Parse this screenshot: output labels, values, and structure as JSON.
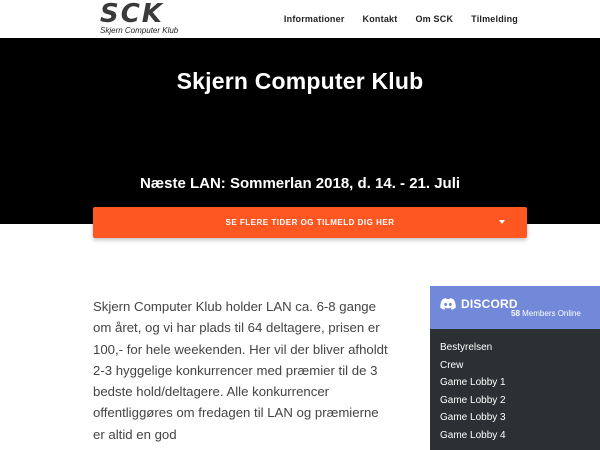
{
  "header": {
    "logo_text": "SCK",
    "logo_subtitle": "Skjern Computer Klub",
    "nav": [
      "Informationer",
      "Kontakt",
      "Om SCK",
      "Tilmelding"
    ]
  },
  "hero": {
    "title": "Skjern Computer Klub",
    "subtitle": "Næste LAN: Sommerlan 2018, d. 14. - 21. Juli"
  },
  "cta": {
    "label": "SE FLERE TIDER OG TILMELD DIG HER",
    "color": "#ff5722"
  },
  "intro": {
    "text": "Skjern Computer Klub holder LAN ca. 6-8 gange om året, og vi har plads til 64 deltagere, prisen er 100,- for hele weekenden. Her vil der bliver afholdt 2-3 hyggelige konkurrencer med præmier til de 3 bedste hold/deltagere. Alle konkurrencer offentliggøres om fredagen til LAN og præmierne er altid en god"
  },
  "discord": {
    "brand": "DISCORD",
    "members_count": "58",
    "members_label": "Members Online",
    "header_color": "#7289da",
    "channels": [
      "Bestyrelsen",
      "Crew",
      "Game Lobby 1",
      "Game Lobby 2",
      "Game Lobby 3",
      "Game Lobby 4"
    ]
  }
}
